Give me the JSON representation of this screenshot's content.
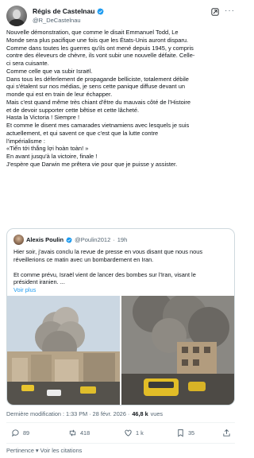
{
  "author": {
    "display_name": "Régis de Castelnau",
    "handle": "@R_DeCastelnau"
  },
  "tweet": {
    "text": "Nouvelle démonstration, que comme le disait Emmanuel Todd, Le\nMonde sera plus pacifique une fois que les États-Unis auront disparu.\nComme dans toutes les guerres qu'ils ont mené depuis 1945, y compris\ncontre des éleveurs de chèvre, ils vont subir une nouvelle défaite. Celle-\nci sera cuisante.\nComme celle que va subir Israël.\nDans tous les déferlement de propagande belliciste, totalement débile\nqui s'étalent sur nos médias, je sens cette panique diffuse devant un\nmonde qui est en train de leur échapper.\nMais c'est quand même très chiant d'être du mauvais côté de l'Histoire\net de devoir supporter cette bêtise et cette lâcheté.\nHasta la Victoria ! Siempre !\nEt comme le disent mes camarades vietnamiens avec lesquels je suis\nactuellement, et qui savent ce que c'est que la lutte contre\nl'impérialisme :\n«Tiến tới thắng lợi hoàn toàn! »\nEn avant jusqu'à la victoire, finale !\nJ'espère que Darwin me prêtera vie pour que je puisse y assister."
  },
  "quoted_tweet": {
    "display_name": "Alexis Poulin",
    "handle": "@Poulin2012",
    "time": "19h",
    "text": "Hier soir, j'avais conclu la revue de presse en vous disant que nous nous\nréveillerions ce matin avec un bombardement en Iran.\n\nEt comme prévu, Israël vient de lancer des bombes sur l'Iran, visant le\nprésident iranien. ...",
    "see_more": "Voir plus"
  },
  "meta": {
    "modified_label": "Dernière modification : 1:33 PM · 28 févr. 2026 ·",
    "views_count": "46,8 k",
    "views_label": "vues"
  },
  "actions": {
    "replies": "89",
    "retweets": "418",
    "likes": "1 k",
    "bookmarks": "35"
  },
  "footer": {
    "translation_label": "Pertinence ▾  Voir les citations"
  },
  "colors": {
    "accent": "#1d9bf0",
    "muted_text": "#536471",
    "border": "#cfd9de"
  }
}
